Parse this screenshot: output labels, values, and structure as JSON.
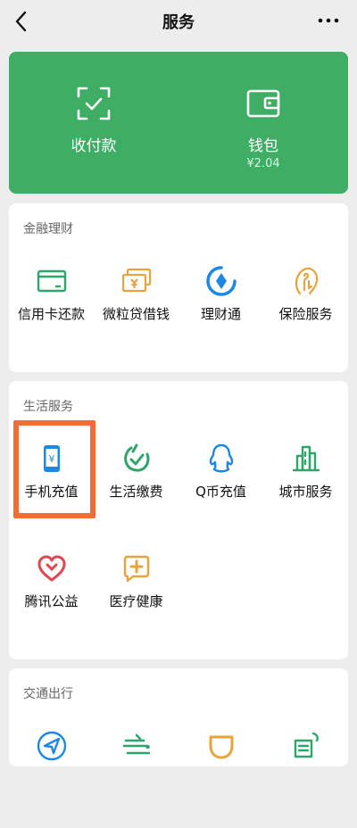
{
  "nav": {
    "title": "服务"
  },
  "wallet_card": {
    "items": [
      {
        "label": "收付款",
        "icon": "scan-qr-icon"
      },
      {
        "label": "钱包",
        "sub": "¥2.04",
        "icon": "wallet-icon"
      }
    ],
    "background": "#3fae65"
  },
  "sections": [
    {
      "title": "金融理财",
      "items": [
        {
          "label": "信用卡还款",
          "icon": "credit-card-icon",
          "color": "#2ea56a"
        },
        {
          "label": "微粒贷借钱",
          "icon": "loan-icon",
          "color": "#e8a33d"
        },
        {
          "label": "理财通",
          "icon": "wealth-icon",
          "color": "#1d87e4"
        },
        {
          "label": "保险服务",
          "icon": "insurance-icon",
          "color": "#e8a33d"
        }
      ]
    },
    {
      "title": "生活服务",
      "items": [
        {
          "label": "手机充值",
          "icon": "phone-recharge-icon",
          "color": "#1d87e4"
        },
        {
          "label": "生活缴费",
          "icon": "utility-bill-icon",
          "color": "#2ea56a"
        },
        {
          "label": "Q币充值",
          "icon": "qq-coin-icon",
          "color": "#1d87e4"
        },
        {
          "label": "城市服务",
          "icon": "city-service-icon",
          "color": "#2ea56a"
        },
        {
          "label": "腾讯公益",
          "icon": "charity-icon",
          "color": "#e0484f"
        },
        {
          "label": "医疗健康",
          "icon": "medical-icon",
          "color": "#e8a33d"
        }
      ]
    },
    {
      "title": "交通出行",
      "items": [
        {
          "label": "",
          "icon": "navigation-icon",
          "color": "#1d87e4"
        },
        {
          "label": "",
          "icon": "train-icon",
          "color": "#2ea56a"
        },
        {
          "label": "",
          "icon": "didi-icon",
          "color": "#e8a33d"
        },
        {
          "label": "",
          "icon": "hotel-icon",
          "color": "#2ea56a"
        }
      ]
    }
  ],
  "highlight_color": "#f26b3a"
}
